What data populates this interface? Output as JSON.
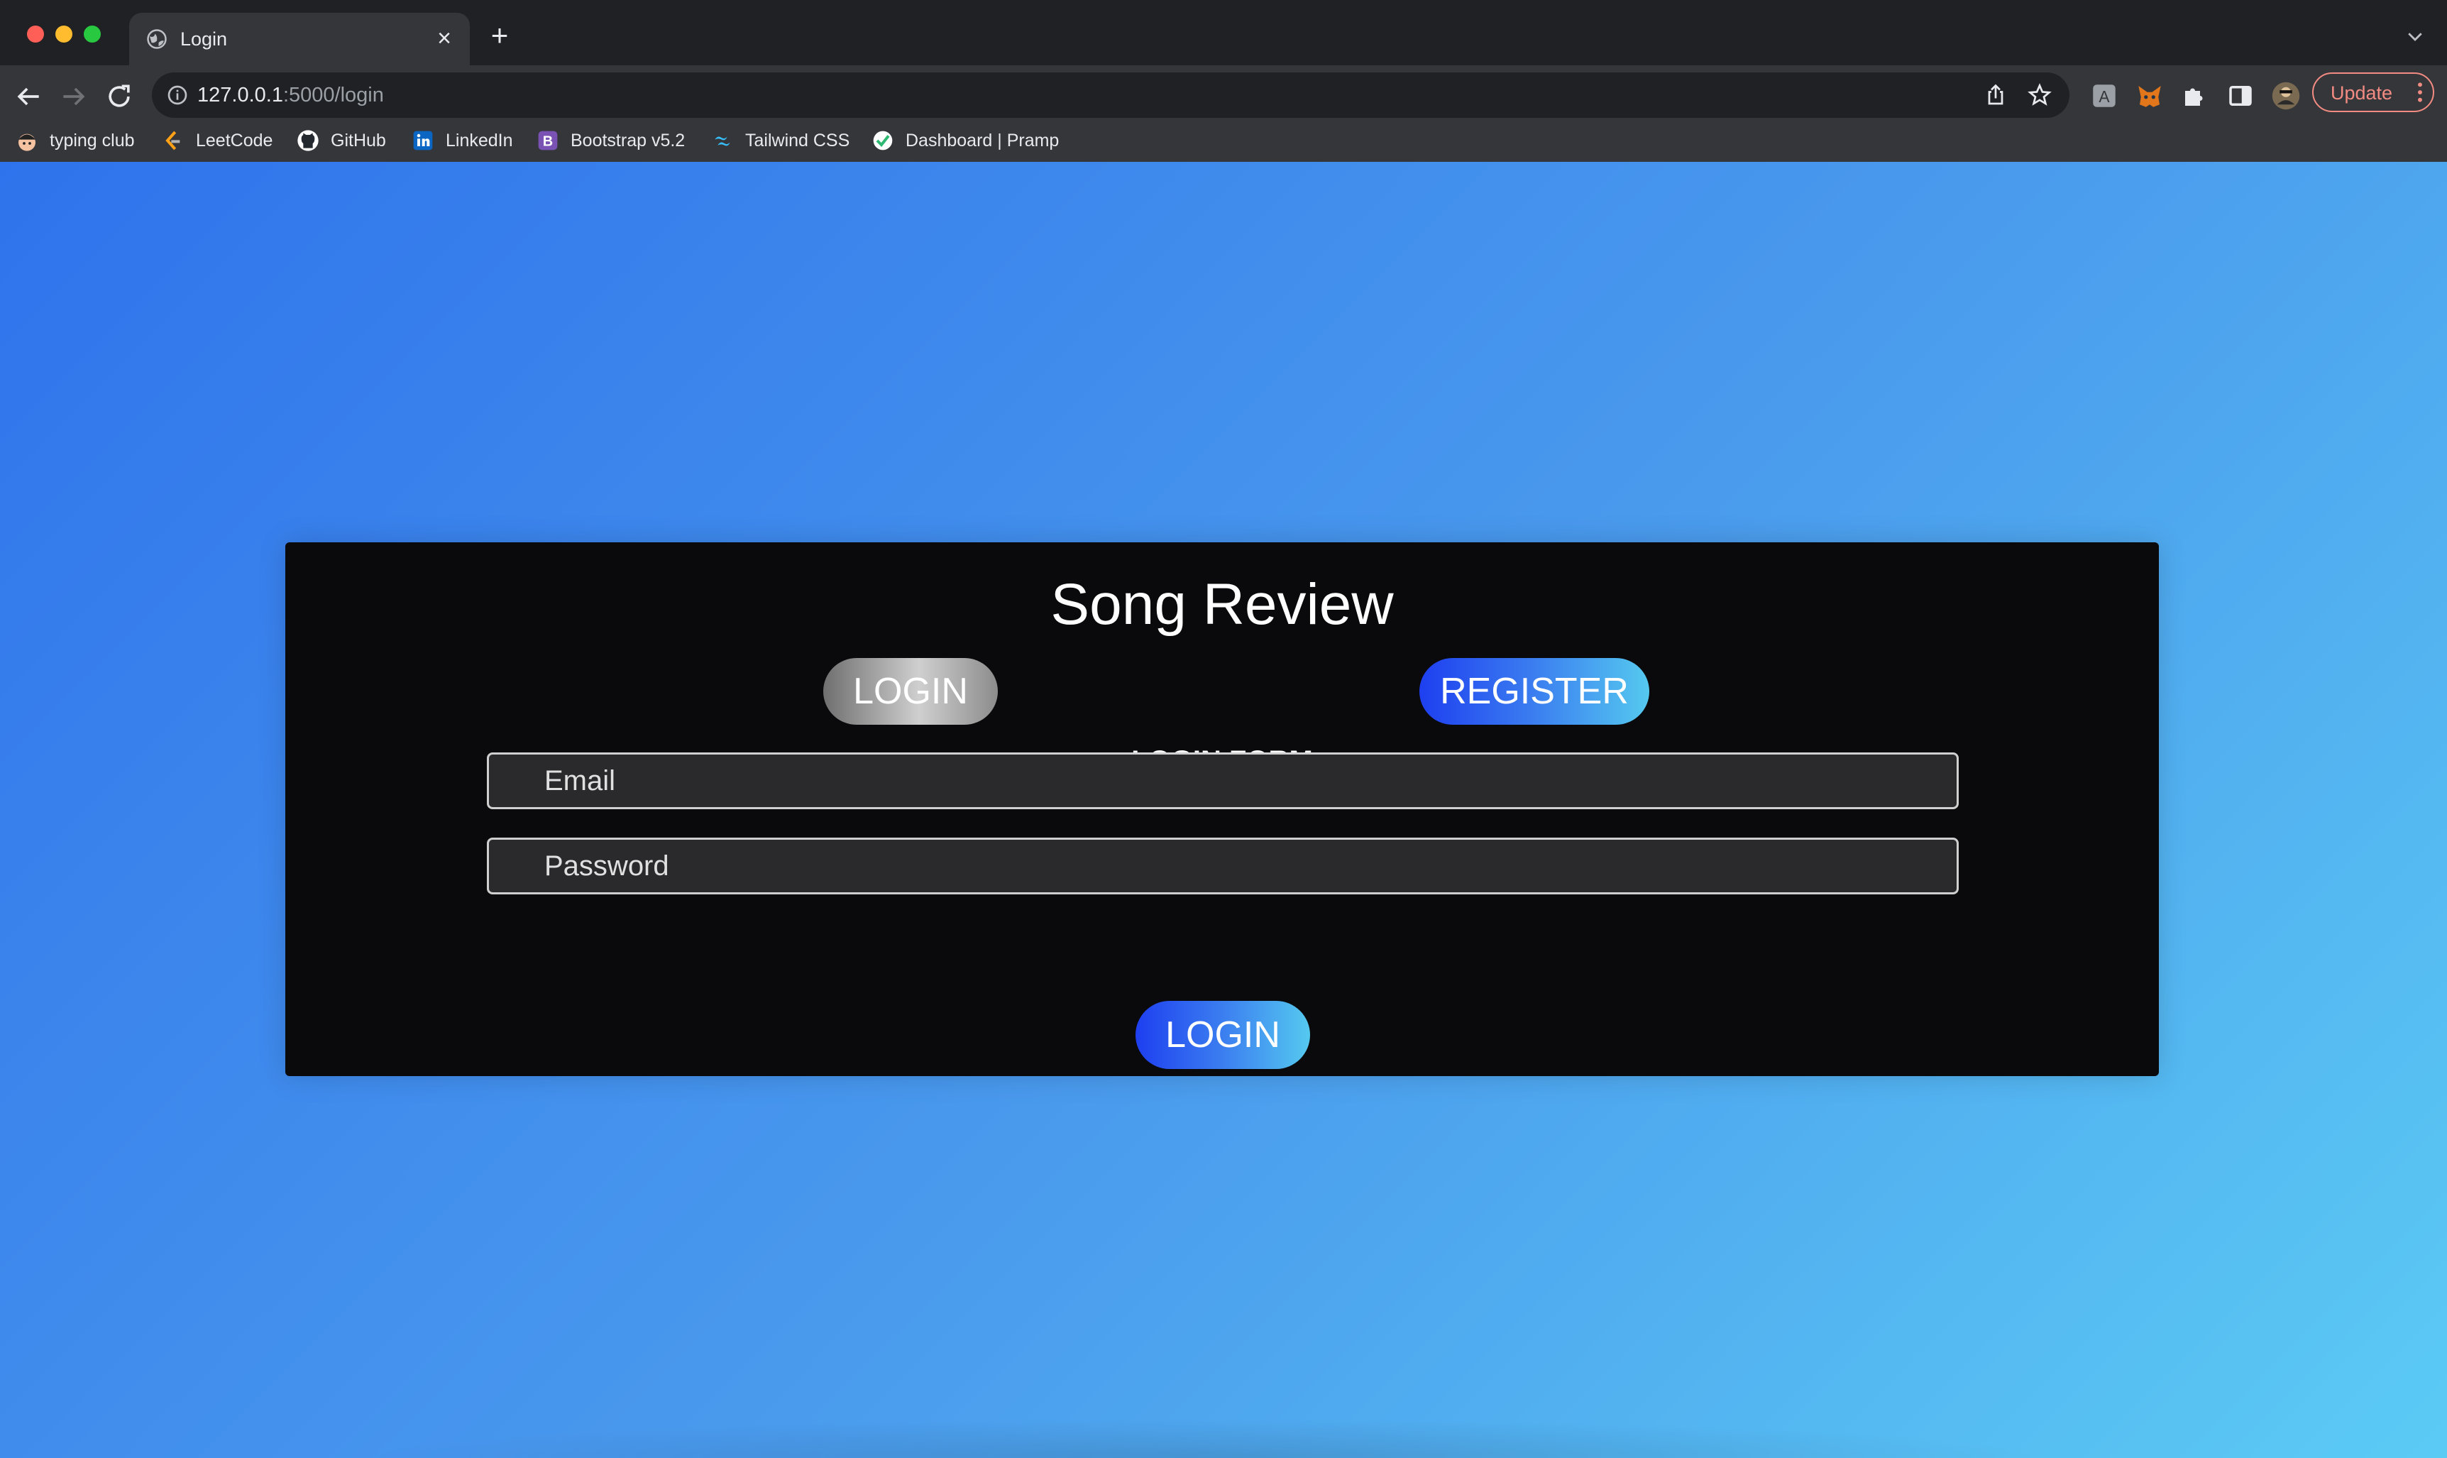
{
  "browser": {
    "tab": {
      "title": "Login",
      "favicon": "globe-icon"
    },
    "address_bar": {
      "host": "127.0.0.1",
      "rest": ":5000/login"
    },
    "update_button": {
      "label": "Update"
    },
    "bookmarks": [
      {
        "label": "typing club",
        "icon": "typing-club-icon"
      },
      {
        "label": "LeetCode",
        "icon": "leetcode-icon"
      },
      {
        "label": "GitHub",
        "icon": "github-icon"
      },
      {
        "label": "LinkedIn",
        "icon": "linkedin-icon"
      },
      {
        "label": "Bootstrap v5.2",
        "icon": "bootstrap-icon"
      },
      {
        "label": "Tailwind CSS",
        "icon": "tailwind-icon"
      },
      {
        "label": "Dashboard | Pramp",
        "icon": "pramp-icon"
      }
    ]
  },
  "page": {
    "title": "Song Review",
    "tabs": {
      "login": "LOGIN",
      "register": "REGISTER"
    },
    "form": {
      "heading": "LOGIN FORM",
      "email_placeholder": "Email",
      "password_placeholder": "Password",
      "submit_label": "LOGIN"
    }
  },
  "colors": {
    "page_gradient": [
      "#2f73ec",
      "#5bcbf4"
    ],
    "card_background": "#0a090b",
    "button_gradient": [
      "#1e3ff0",
      "#55c9ef"
    ],
    "inactive_tab": "#cfcfcf",
    "update_accent": "#f28b82"
  }
}
